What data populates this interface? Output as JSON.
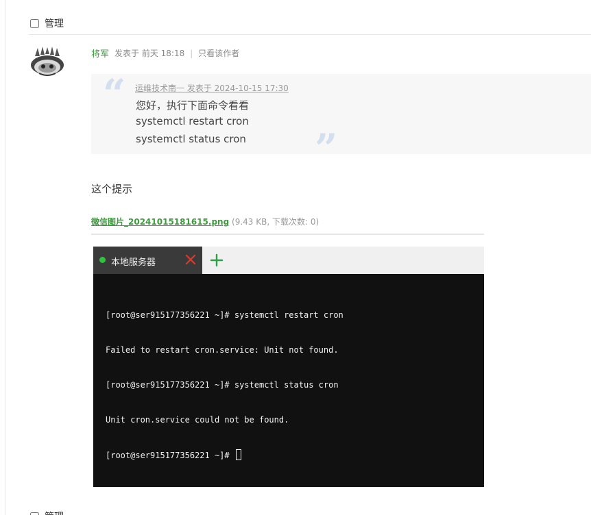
{
  "manage": {
    "label": "管理"
  },
  "post": {
    "author": "将军",
    "posted": "发表于 前天 18:18",
    "separator": "|",
    "only_author": "只看该作者",
    "quote": {
      "source": "运维技术南一 发表于 2024-10-15 17:30",
      "lines": [
        "您好，执行下面命令看看",
        "systemctl restart cron",
        "systemctl status cron"
      ]
    },
    "reply": "这个提示",
    "attachment": {
      "filename": "微信图片_20241015181615.png",
      "info": "(9.43 KB, 下载次数: 0)"
    }
  },
  "screenshot": {
    "tab_label": "本地服务器",
    "status_color": "#2ec43e",
    "close_color": "#d93a2b",
    "add_color": "#2ea043",
    "terminal_lines": [
      "[root@ser915177356221 ~]# systemctl restart cron",
      "Failed to restart cron.service: Unit not found.",
      "[root@ser915177356221 ~]# systemctl status cron",
      "Unit cron.service could not be found.",
      "[root@ser915177356221 ~]# "
    ]
  },
  "colors": {
    "accent": "#3d9a3d",
    "quote_bg": "#f7f7f7",
    "quote_mark": "#d3dfee",
    "terminal_bg": "#111111"
  }
}
